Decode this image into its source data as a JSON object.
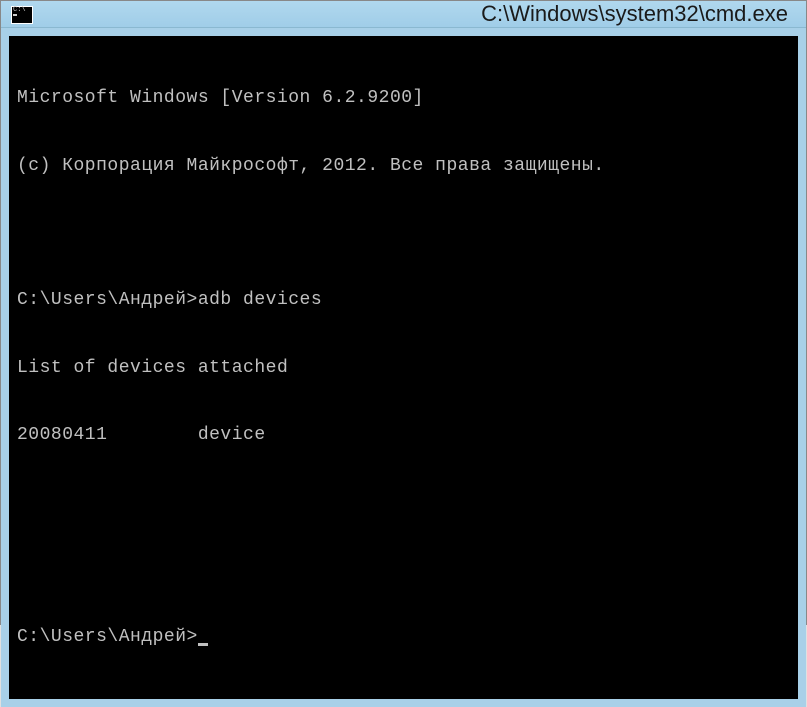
{
  "window": {
    "title": "C:\\Windows\\system32\\cmd.exe"
  },
  "console": {
    "lines": {
      "banner1": "Microsoft Windows [Version 6.2.9200]",
      "banner2": "(c) Корпорация Майкрософт, 2012. Все права защищены.",
      "blank1": "",
      "prompt1_path": "C:\\Users\\Андрей>",
      "prompt1_cmd": "adb devices",
      "output1": "List of devices attached",
      "output2": "20080411        device",
      "blank2": "",
      "blank3": "",
      "prompt2_path": "C:\\Users\\Андрей>"
    }
  }
}
